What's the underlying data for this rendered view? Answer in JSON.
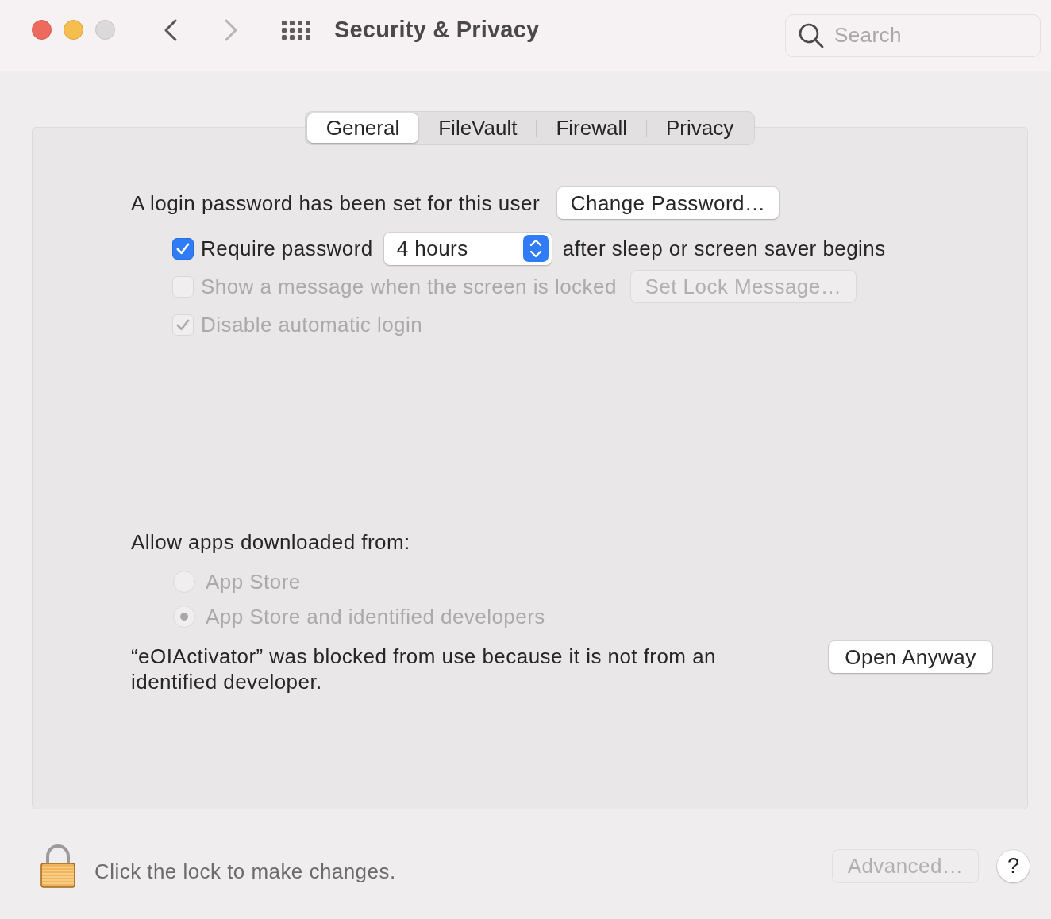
{
  "window": {
    "title": "Security & Privacy",
    "controls": [
      {
        "kind": "close",
        "disabled": false
      },
      {
        "kind": "minimize",
        "disabled": false
      },
      {
        "kind": "zoom",
        "disabled": true
      }
    ],
    "nav": [
      {
        "kind": "back",
        "disabled": false
      },
      {
        "kind": "forward",
        "disabled": true
      }
    ]
  },
  "search": {
    "placeholder": "Search"
  },
  "tabs": [
    {
      "label": "General",
      "selected": true
    },
    {
      "label": "FileVault",
      "selected": false
    },
    {
      "label": "Firewall",
      "selected": false
    },
    {
      "label": "Privacy",
      "selected": false
    }
  ],
  "general": {
    "login_text": "A login password has been set for this user",
    "change_password": {
      "label": "Change Password…",
      "disabled": false
    },
    "options": [
      {
        "kind": "select",
        "label": "Require password",
        "checked": true,
        "disabled": false,
        "select_value": "4 hours",
        "suffix": "after sleep or screen saver begins"
      },
      {
        "kind": "button",
        "label": "Show a message when the screen is locked",
        "checked": false,
        "disabled": true,
        "button": {
          "label": "Set Lock Message…",
          "disabled": true
        }
      },
      {
        "kind": "plain",
        "label": "Disable automatic login",
        "checked": true,
        "disabled": true
      }
    ]
  },
  "allow_apps": {
    "heading": "Allow apps downloaded from:",
    "options": [
      {
        "label": "App Store",
        "selected": false,
        "disabled": true
      },
      {
        "label": "App Store and identified developers",
        "selected": true,
        "disabled": true
      }
    ]
  },
  "blocked": {
    "message": "“eOIActivator” was blocked from use because it is not from an identified developer.",
    "button": {
      "label": "Open Anyway",
      "disabled": false
    }
  },
  "footer": {
    "lock_text": "Click the lock to make changes.",
    "locked": true,
    "advanced": {
      "label": "Advanced…",
      "disabled": true
    },
    "help": {
      "label": "?"
    }
  }
}
